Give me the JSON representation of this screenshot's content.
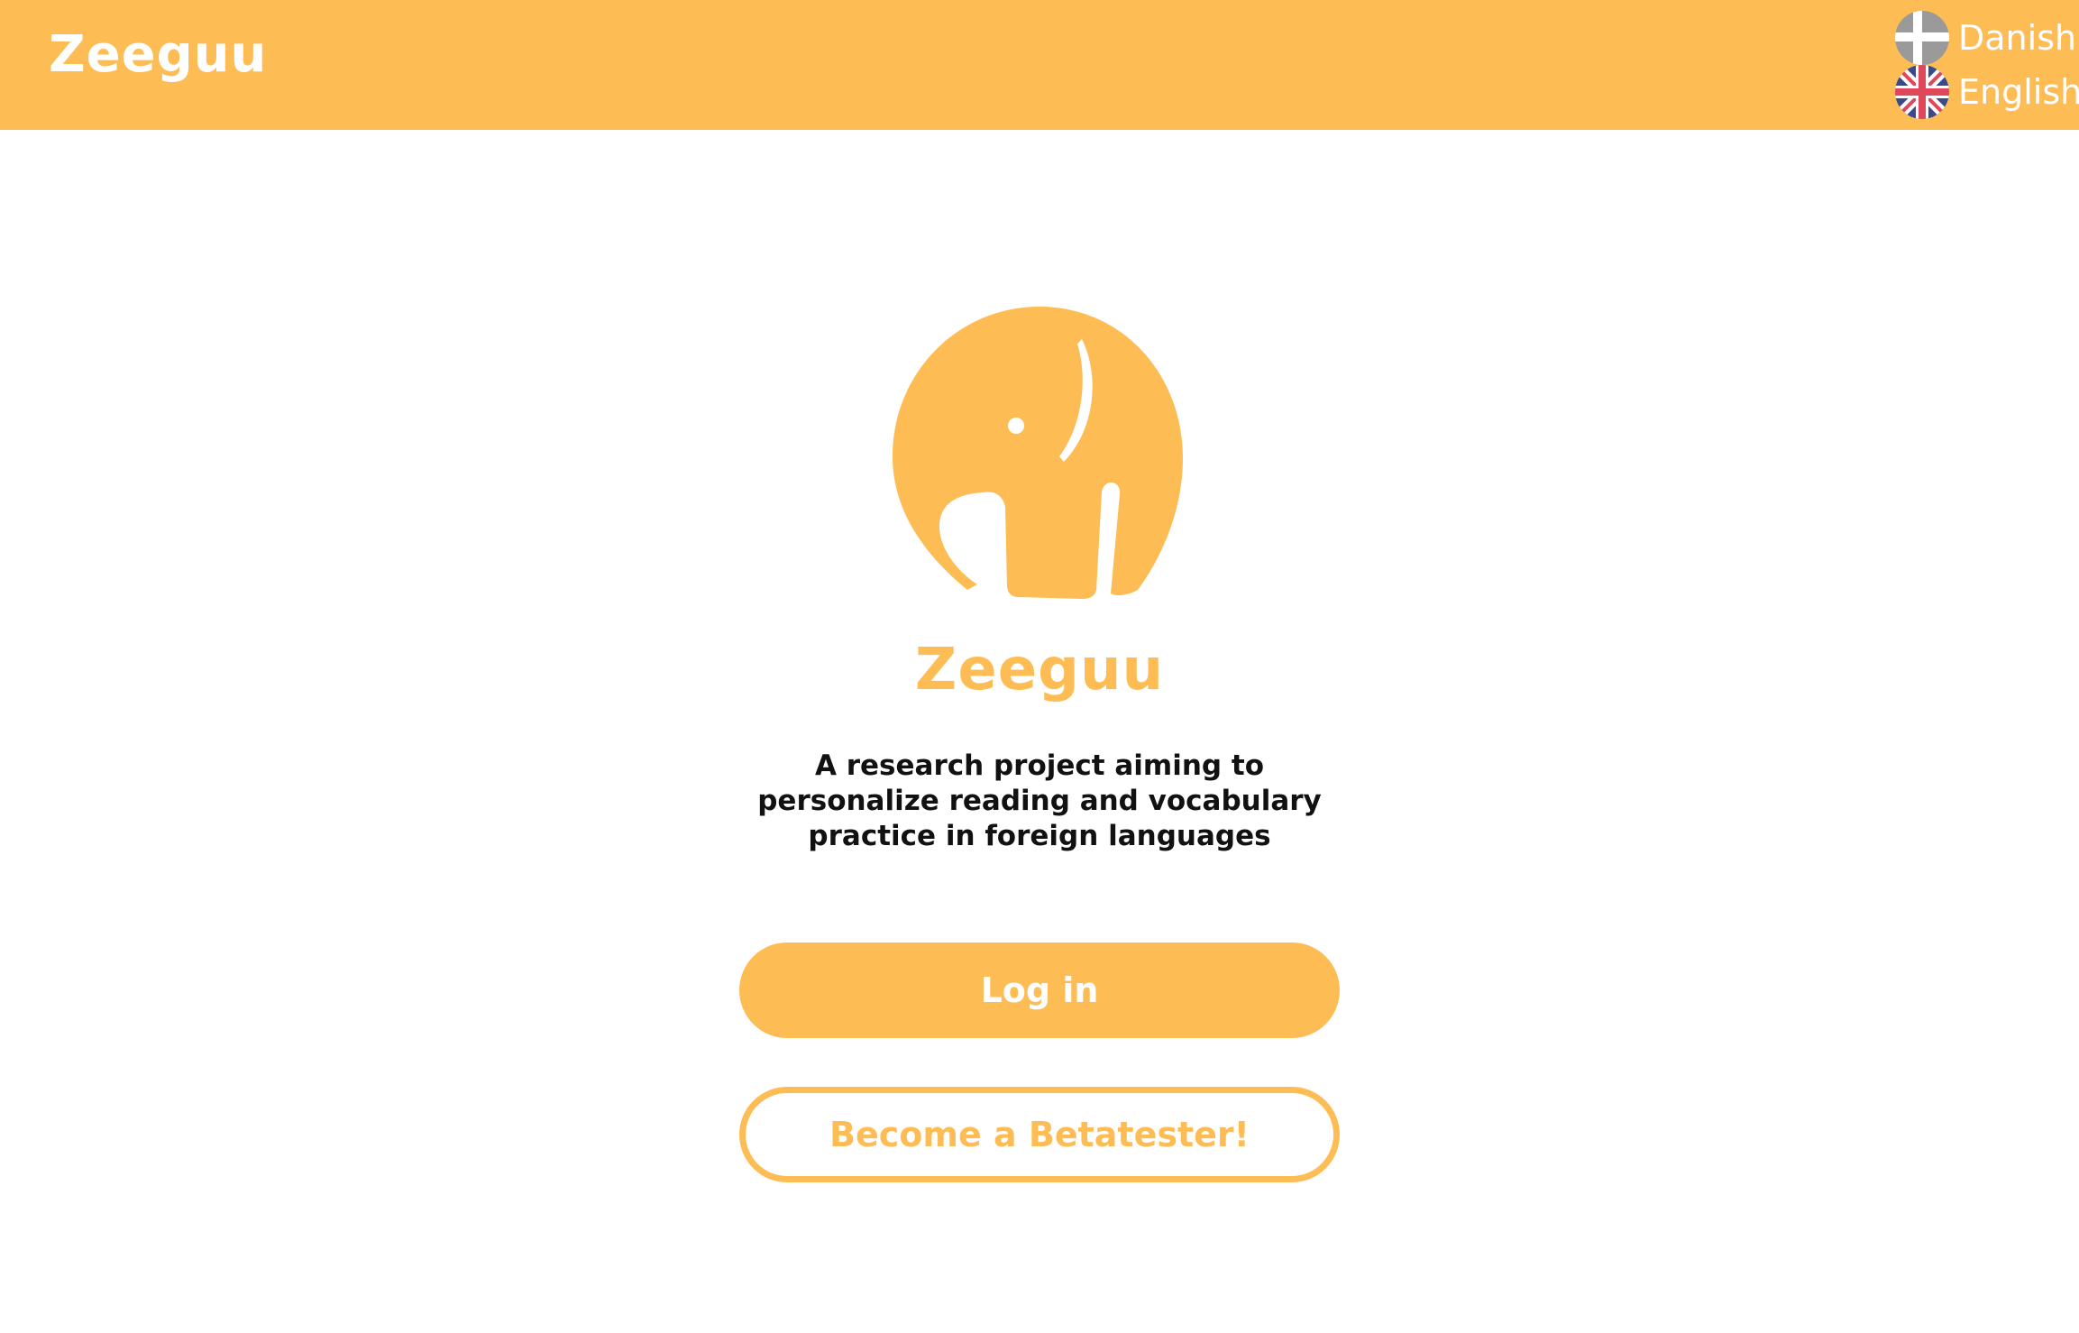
{
  "header": {
    "brand": "Zeeguu",
    "languages": [
      {
        "label": "Danish",
        "flag": "danish-flag-icon"
      },
      {
        "label": "English",
        "flag": "uk-flag-icon"
      }
    ]
  },
  "main": {
    "logo": "elephant-logo-icon",
    "title": "Zeeguu",
    "tagline": "A research project aiming to personalize reading and vocabulary practice in foreign languages",
    "login_label": "Log in",
    "betatester_label": "Become a Betatester!"
  },
  "colors": {
    "accent": "#FEBC55",
    "text": "#111111",
    "background": "#FFFFFF"
  }
}
